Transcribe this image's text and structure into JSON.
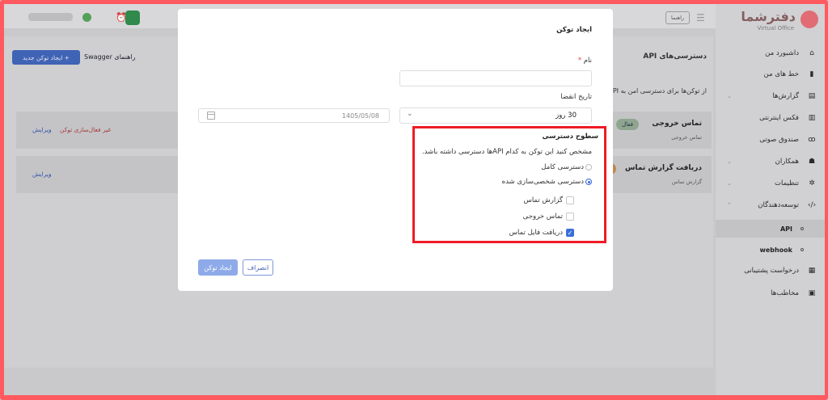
{
  "app": {
    "logo_text": "دفترشما",
    "logo_subtitle": "Virtual Office",
    "top_chip": "راهنما"
  },
  "sidebar": {
    "items": [
      {
        "label": "داشبورد من",
        "icon": "home-icon",
        "glyph": "⌂"
      },
      {
        "label": "خط های من",
        "icon": "sim-icon",
        "glyph": "▮"
      },
      {
        "label": "گزارش‌ها",
        "icon": "report-icon",
        "glyph": "▤",
        "chevron": "⌄"
      },
      {
        "label": "فکس اینترنتی",
        "icon": "fax-icon",
        "glyph": "▥"
      },
      {
        "label": "صندوق صوتی",
        "icon": "voicemail-icon",
        "glyph": "ꝏ"
      },
      {
        "label": "همکاران",
        "icon": "users-icon",
        "glyph": "☗",
        "chevron": "⌄"
      },
      {
        "label": "تنظیمات",
        "icon": "gear-icon",
        "glyph": "✲",
        "chevron": "⌄"
      },
      {
        "label": "توسعه‌دهندگان",
        "icon": "code-icon",
        "glyph": "‹/›",
        "chevron": "⌃"
      }
    ],
    "sub_items": [
      {
        "label": "API",
        "active": true
      },
      {
        "label": "webhook",
        "active": false
      }
    ],
    "bottom_items": [
      {
        "label": "درخواست پشتیبانی",
        "icon": "support-icon",
        "glyph": "▦"
      },
      {
        "label": "مخاطب‌ها",
        "icon": "contacts-icon",
        "glyph": "▣"
      }
    ]
  },
  "background": {
    "title": "دسترسی‌های API",
    "description": "از توکن‌ها برای دسترسی امن به API",
    "new_token_button": "+ ایجاد توکن جدید",
    "swagger_link": "راهنمای Swagger",
    "rows": [
      {
        "name": "تماس خروجی",
        "badge": "فعال",
        "sub": "تماس خروجی",
        "deactivate": "غیر فعال‌سازی توکن",
        "edit": "ویرایش"
      },
      {
        "name": "دریافت گزارش تماس",
        "badge": "...",
        "sub": "گزارش تماس",
        "deactivate": "",
        "edit": "ویرایش"
      }
    ]
  },
  "modal": {
    "title": "ایجاد توکن",
    "name_label": "نام",
    "required_mark": "*",
    "name_value": "",
    "expiry_label": "تاریخ انقضا",
    "expiry_selected": "30 روز",
    "expiry_chevron": "⌄",
    "expiry_date": "1405/05/08",
    "access_title": "سطوح دسترسی",
    "access_description": "مشخص کنید این توکن به کدام APIها دسترسی داشته باشد.",
    "radios": [
      {
        "label": "دسترسی کامل",
        "checked": false
      },
      {
        "label": "دسترسی شخصی‌سازی شده",
        "checked": true
      }
    ],
    "checkboxes": [
      {
        "label": "گزارش تماس",
        "checked": false
      },
      {
        "label": "تماس خروجی",
        "checked": false
      },
      {
        "label": "دریافت فایل تماس",
        "checked": true
      }
    ],
    "create_button": "ایجاد توکن",
    "cancel_button": "انصراف"
  },
  "colors": {
    "accent": "#3b6fd8",
    "highlight_border": "#ee1c25",
    "frame": "#ff5a5f"
  }
}
